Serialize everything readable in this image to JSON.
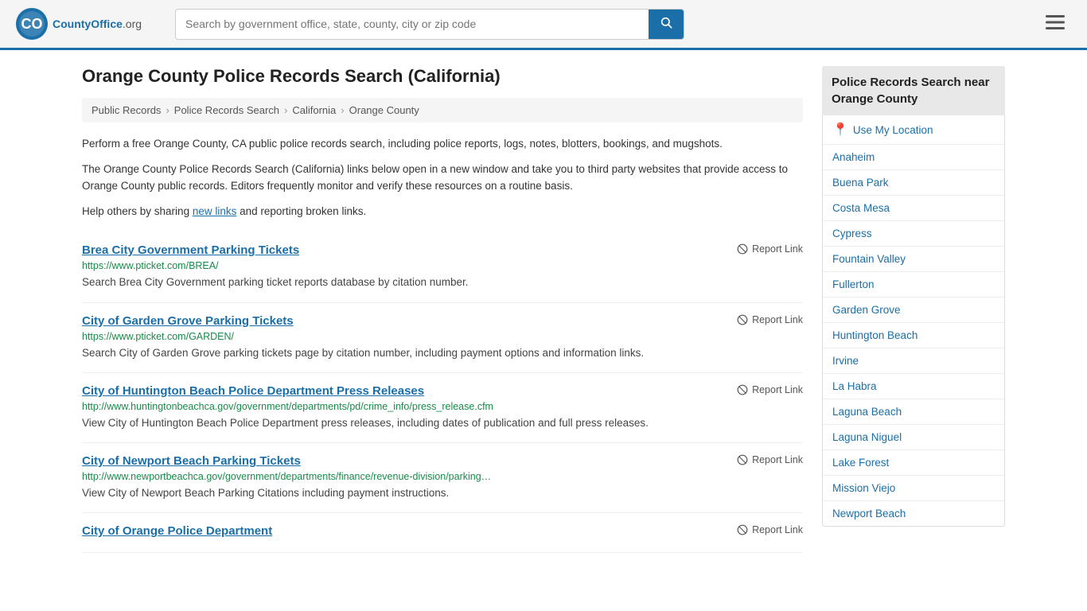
{
  "header": {
    "logo_text": "CountyOffice",
    "logo_suffix": ".org",
    "search_placeholder": "Search by government office, state, county, city or zip code",
    "search_value": ""
  },
  "page": {
    "title": "Orange County Police Records Search (California)"
  },
  "breadcrumb": {
    "items": [
      {
        "label": "Public Records",
        "href": "#"
      },
      {
        "label": "Police Records Search",
        "href": "#"
      },
      {
        "label": "California",
        "href": "#"
      },
      {
        "label": "Orange County",
        "href": "#"
      }
    ]
  },
  "description": {
    "para1": "Perform a free Orange County, CA public police records search, including police reports, logs, notes, blotters, bookings, and mugshots.",
    "para2": "The Orange County Police Records Search (California) links below open in a new window and take you to third party websites that provide access to Orange County public records. Editors frequently monitor and verify these resources on a routine basis.",
    "para3_before": "Help others by sharing ",
    "new_links_text": "new links",
    "para3_after": " and reporting broken links."
  },
  "results": [
    {
      "title": "Brea City Government Parking Tickets",
      "url": "https://www.pticket.com/BREA/",
      "desc": "Search Brea City Government parking ticket reports database by citation number.",
      "report_label": "Report Link"
    },
    {
      "title": "City of Garden Grove Parking Tickets",
      "url": "https://www.pticket.com/GARDEN/",
      "desc": "Search City of Garden Grove parking tickets page by citation number, including payment options and information links.",
      "report_label": "Report Link"
    },
    {
      "title": "City of Huntington Beach Police Department Press Releases",
      "url": "http://www.huntingtonbeachca.gov/government/departments/pd/crime_info/press_release.cfm",
      "desc": "View City of Huntington Beach Police Department press releases, including dates of publication and full press releases.",
      "report_label": "Report Link"
    },
    {
      "title": "City of Newport Beach Parking Tickets",
      "url": "http://www.newportbeachca.gov/government/departments/finance/revenue-division/parking…",
      "desc": "View City of Newport Beach Parking Citations including payment instructions.",
      "report_label": "Report Link"
    },
    {
      "title": "City of Orange Police Department",
      "url": "",
      "desc": "",
      "report_label": "Report Link"
    }
  ],
  "sidebar": {
    "title": "Police Records Search near Orange County",
    "use_my_location": "Use My Location",
    "links": [
      "Anaheim",
      "Buena Park",
      "Costa Mesa",
      "Cypress",
      "Fountain Valley",
      "Fullerton",
      "Garden Grove",
      "Huntington Beach",
      "Irvine",
      "La Habra",
      "Laguna Beach",
      "Laguna Niguel",
      "Lake Forest",
      "Mission Viejo",
      "Newport Beach"
    ]
  }
}
